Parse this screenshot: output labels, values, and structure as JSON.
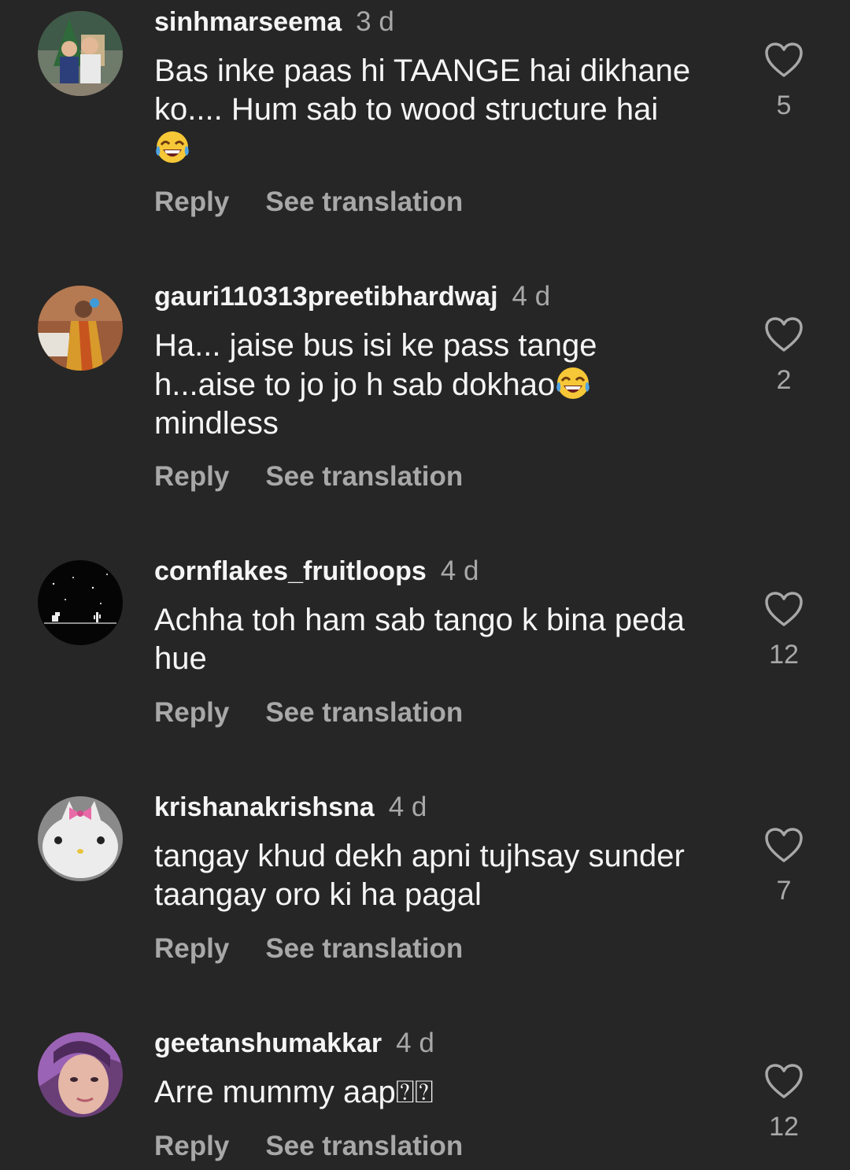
{
  "comments": [
    {
      "username": "sinhmarseema",
      "time": "3 d",
      "text_lines": [
        "Bas inke paas hi TAANGE hai dikhane",
        "ko.... Hum sab to wood structure hai"
      ],
      "trailing_emoji": "face-with-tears-of-joy",
      "reply_label": "Reply",
      "translate_label": "See translation",
      "likes": "5"
    },
    {
      "username": "gauri110313preetibhardwaj",
      "time": "4 d",
      "text_lines": [
        "Ha... jaise bus isi ke pass tange",
        "h...aise to jo jo h sab dokhao",
        "mindless"
      ],
      "reply_label": "Reply",
      "translate_label": "See translation",
      "likes": "2"
    },
    {
      "username": "cornflakes_fruitloops",
      "time": "4 d",
      "text_lines": [
        "Achha toh ham sab tango k bina peda",
        "hue"
      ],
      "reply_label": "Reply",
      "translate_label": "See translation",
      "likes": "12"
    },
    {
      "username": "krishanakrishsna",
      "time": "4 d",
      "text_lines": [
        "tangay khud dekh apni tujhsay sunder",
        "taangay oro ki ha pagal"
      ],
      "reply_label": "Reply",
      "translate_label": "See translation",
      "likes": "7"
    },
    {
      "username": "geetanshumakkar",
      "time": "4 d",
      "text_lines": [
        "Arre mummy aap⍰⍰"
      ],
      "reply_label": "Reply",
      "translate_label": "See translation",
      "likes": "12"
    }
  ],
  "colors": {
    "background": "#262626",
    "primary_text": "#f5f5f5",
    "secondary_text": "#a8a8a8"
  },
  "icons": {
    "like": "heart-outline-icon",
    "emoji": "face-with-tears-of-joy"
  }
}
